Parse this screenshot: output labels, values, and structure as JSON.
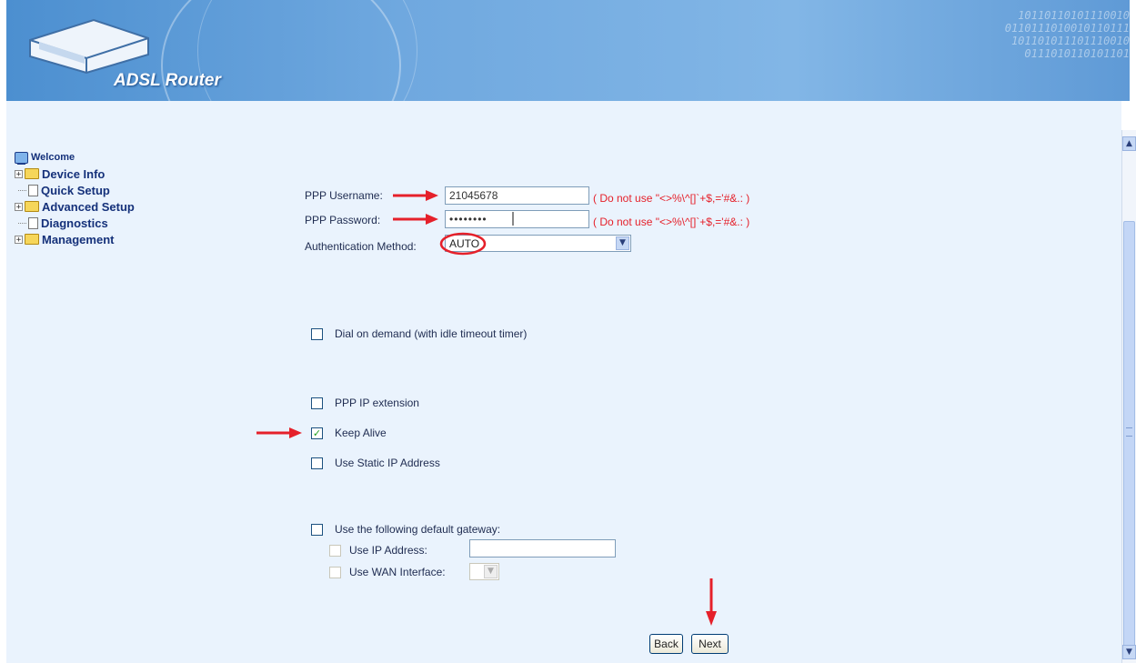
{
  "banner": {
    "brand": "ADSL Router",
    "digits": "10110110101110010\n0110111010010110111\n101101011101110010\n0111010110101101"
  },
  "tree": [
    {
      "label": "Welcome",
      "icon": "computer-icon"
    },
    {
      "label": "Device Info",
      "icon": "folder-icon",
      "expand": "+"
    },
    {
      "label": "Quick Setup",
      "icon": "page-icon"
    },
    {
      "label": "Advanced Setup",
      "icon": "folder-icon",
      "expand": "+"
    },
    {
      "label": "Diagnostics",
      "icon": "page-icon"
    },
    {
      "label": "Management",
      "icon": "folder-icon",
      "expand": "+"
    }
  ],
  "form": {
    "username_label": "PPP Username:",
    "username_value": "21045678",
    "password_label": "PPP Password:",
    "password_value": "••••••••",
    "warning": "( Do not use \"<>%\\^[]`+$,='#&.: )",
    "auth_label": "Authentication Method:",
    "auth_value": "AUTO",
    "dial_on_demand": "Dial on demand (with idle timeout timer)",
    "ppp_ip_extension": "PPP IP extension",
    "keep_alive": "Keep Alive",
    "static_ip": "Use Static IP Address",
    "default_gateway": "Use the following default gateway:",
    "use_ip_address": "Use IP Address:",
    "use_wan_interface": "Use WAN Interface:",
    "checked_mark": "✓",
    "back": "Back",
    "next": "Next"
  },
  "colors": {
    "annotation": "#e5202a",
    "tree_text": "#15317a"
  }
}
